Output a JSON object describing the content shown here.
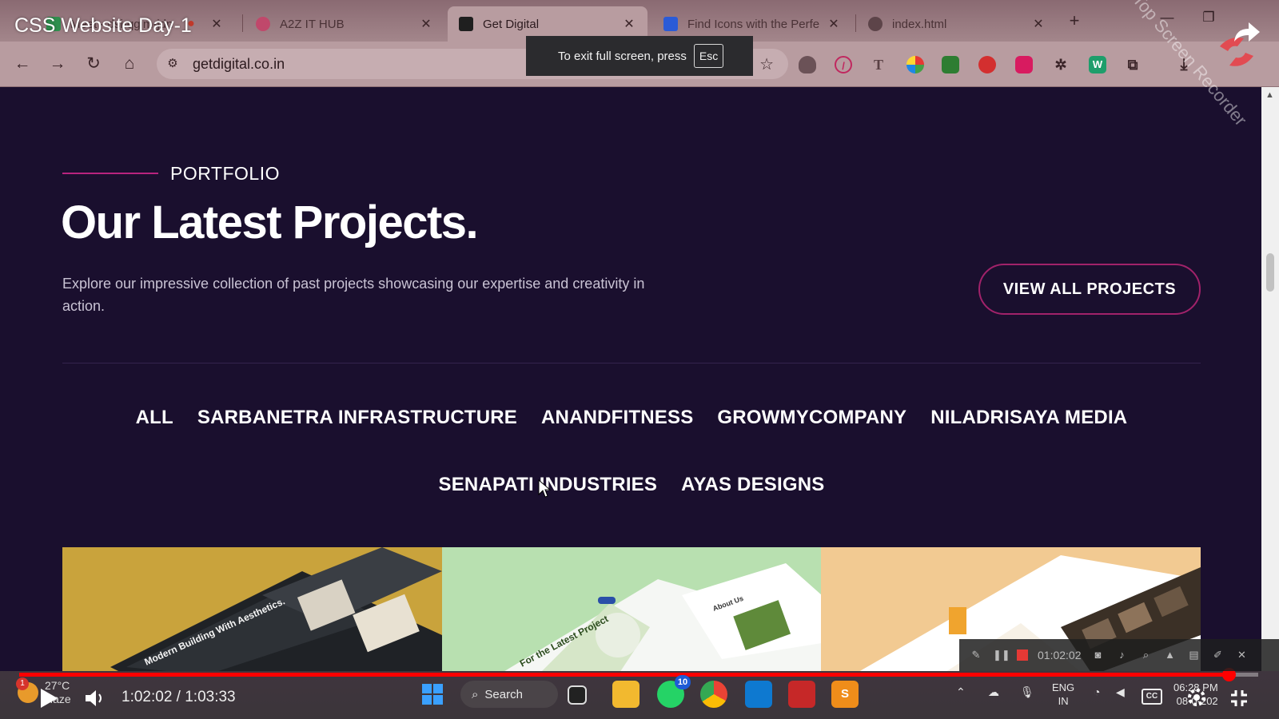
{
  "video": {
    "title": "CSS Website Day-1",
    "current_time": "1:02:02",
    "duration": "1:03:33",
    "time_display": "1:02:02 / 1:03:33",
    "progress": 0.976
  },
  "browser": {
    "tabs": [
      {
        "label": "Meet - dsi-qgjm-jdn",
        "icon": "meet-icon",
        "active": false
      },
      {
        "label": "A2Z IT HUB",
        "icon": "a2z-icon",
        "active": false
      },
      {
        "label": "Get Digital",
        "icon": "getdigital-icon",
        "active": true
      },
      {
        "label": "Find Icons with the Perfe",
        "icon": "flag-icon",
        "active": false
      },
      {
        "label": "index.html",
        "icon": "globe-icon",
        "active": false
      }
    ],
    "url": "getdigital.co.in",
    "fullscreen_toast": "To exit full screen, press",
    "fullscreen_key": "Esc",
    "extensions": [
      "shield-icon",
      "block-icon",
      "text-icon",
      "palette-icon",
      "bulk-icon",
      "record-icon",
      "pen-icon",
      "bug-icon",
      "w-icon",
      "puzzle-icon"
    ]
  },
  "page": {
    "eyebrow": "PORTFOLIO",
    "headline": "Our Latest Projects.",
    "lede": "Explore our impressive collection of past projects showcasing our expertise and creativity in action.",
    "cta": "VIEW ALL PROJECTS",
    "filters_row1": [
      "ALL",
      "SARBANETRA INFRASTRUCTURE",
      "ANANDFITNESS",
      "GROWMYCOMPANY",
      "NILADRISAYA MEDIA"
    ],
    "filters_row2": [
      "SENAPATI INDUSTRIES",
      "AYAS DESIGNS"
    ],
    "thumb_captions": [
      "Modern Building With Aesthetics.",
      "For the Latest Project",
      "About Us"
    ]
  },
  "recorder": {
    "watermark": "iTop Screen Recorder",
    "elapsed": "01:02:02"
  },
  "taskbar": {
    "weather_temp": "27°C",
    "weather_desc": "Haze",
    "weather_badge": "1",
    "search_label": "Search",
    "whatsapp_badge": "10",
    "lang_line1": "ENG",
    "lang_line2": "IN",
    "clock_time": "06:28 PM",
    "clock_date": "08-0-202"
  },
  "colors": {
    "page_bg": "#1a0f2e",
    "accent": "#b8237e",
    "progress": "#ff0000"
  }
}
